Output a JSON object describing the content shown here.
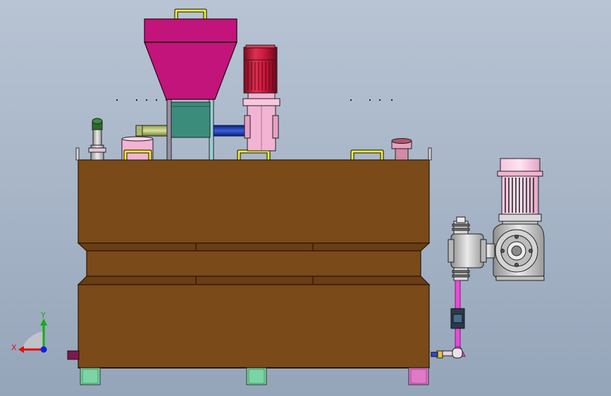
{
  "viewport": {
    "background_top": "#b8c4d4",
    "background_bottom": "#95a5b9"
  },
  "triad": {
    "x_label": "X",
    "y_label": "Y",
    "x_color": "#e01010",
    "y_color": "#10b010",
    "z_color": "#1020e0"
  },
  "colors": {
    "tank_body": "#7a4a18",
    "tank_edge": "#2a1806",
    "hopper": "#c2147a",
    "motor_red": "#c8143c",
    "gearbox_pink": "#f2b4d2",
    "handle_yellow": "#f2ee34",
    "feeder_teal": "#3c8c7c",
    "pipe_blue": "#1f3fb0",
    "pipe_magenta": "#e44cd8",
    "foot_green": "#7cd4a4",
    "foot_pink": "#e07ac8",
    "pump_gray": "#c8c8c8"
  }
}
